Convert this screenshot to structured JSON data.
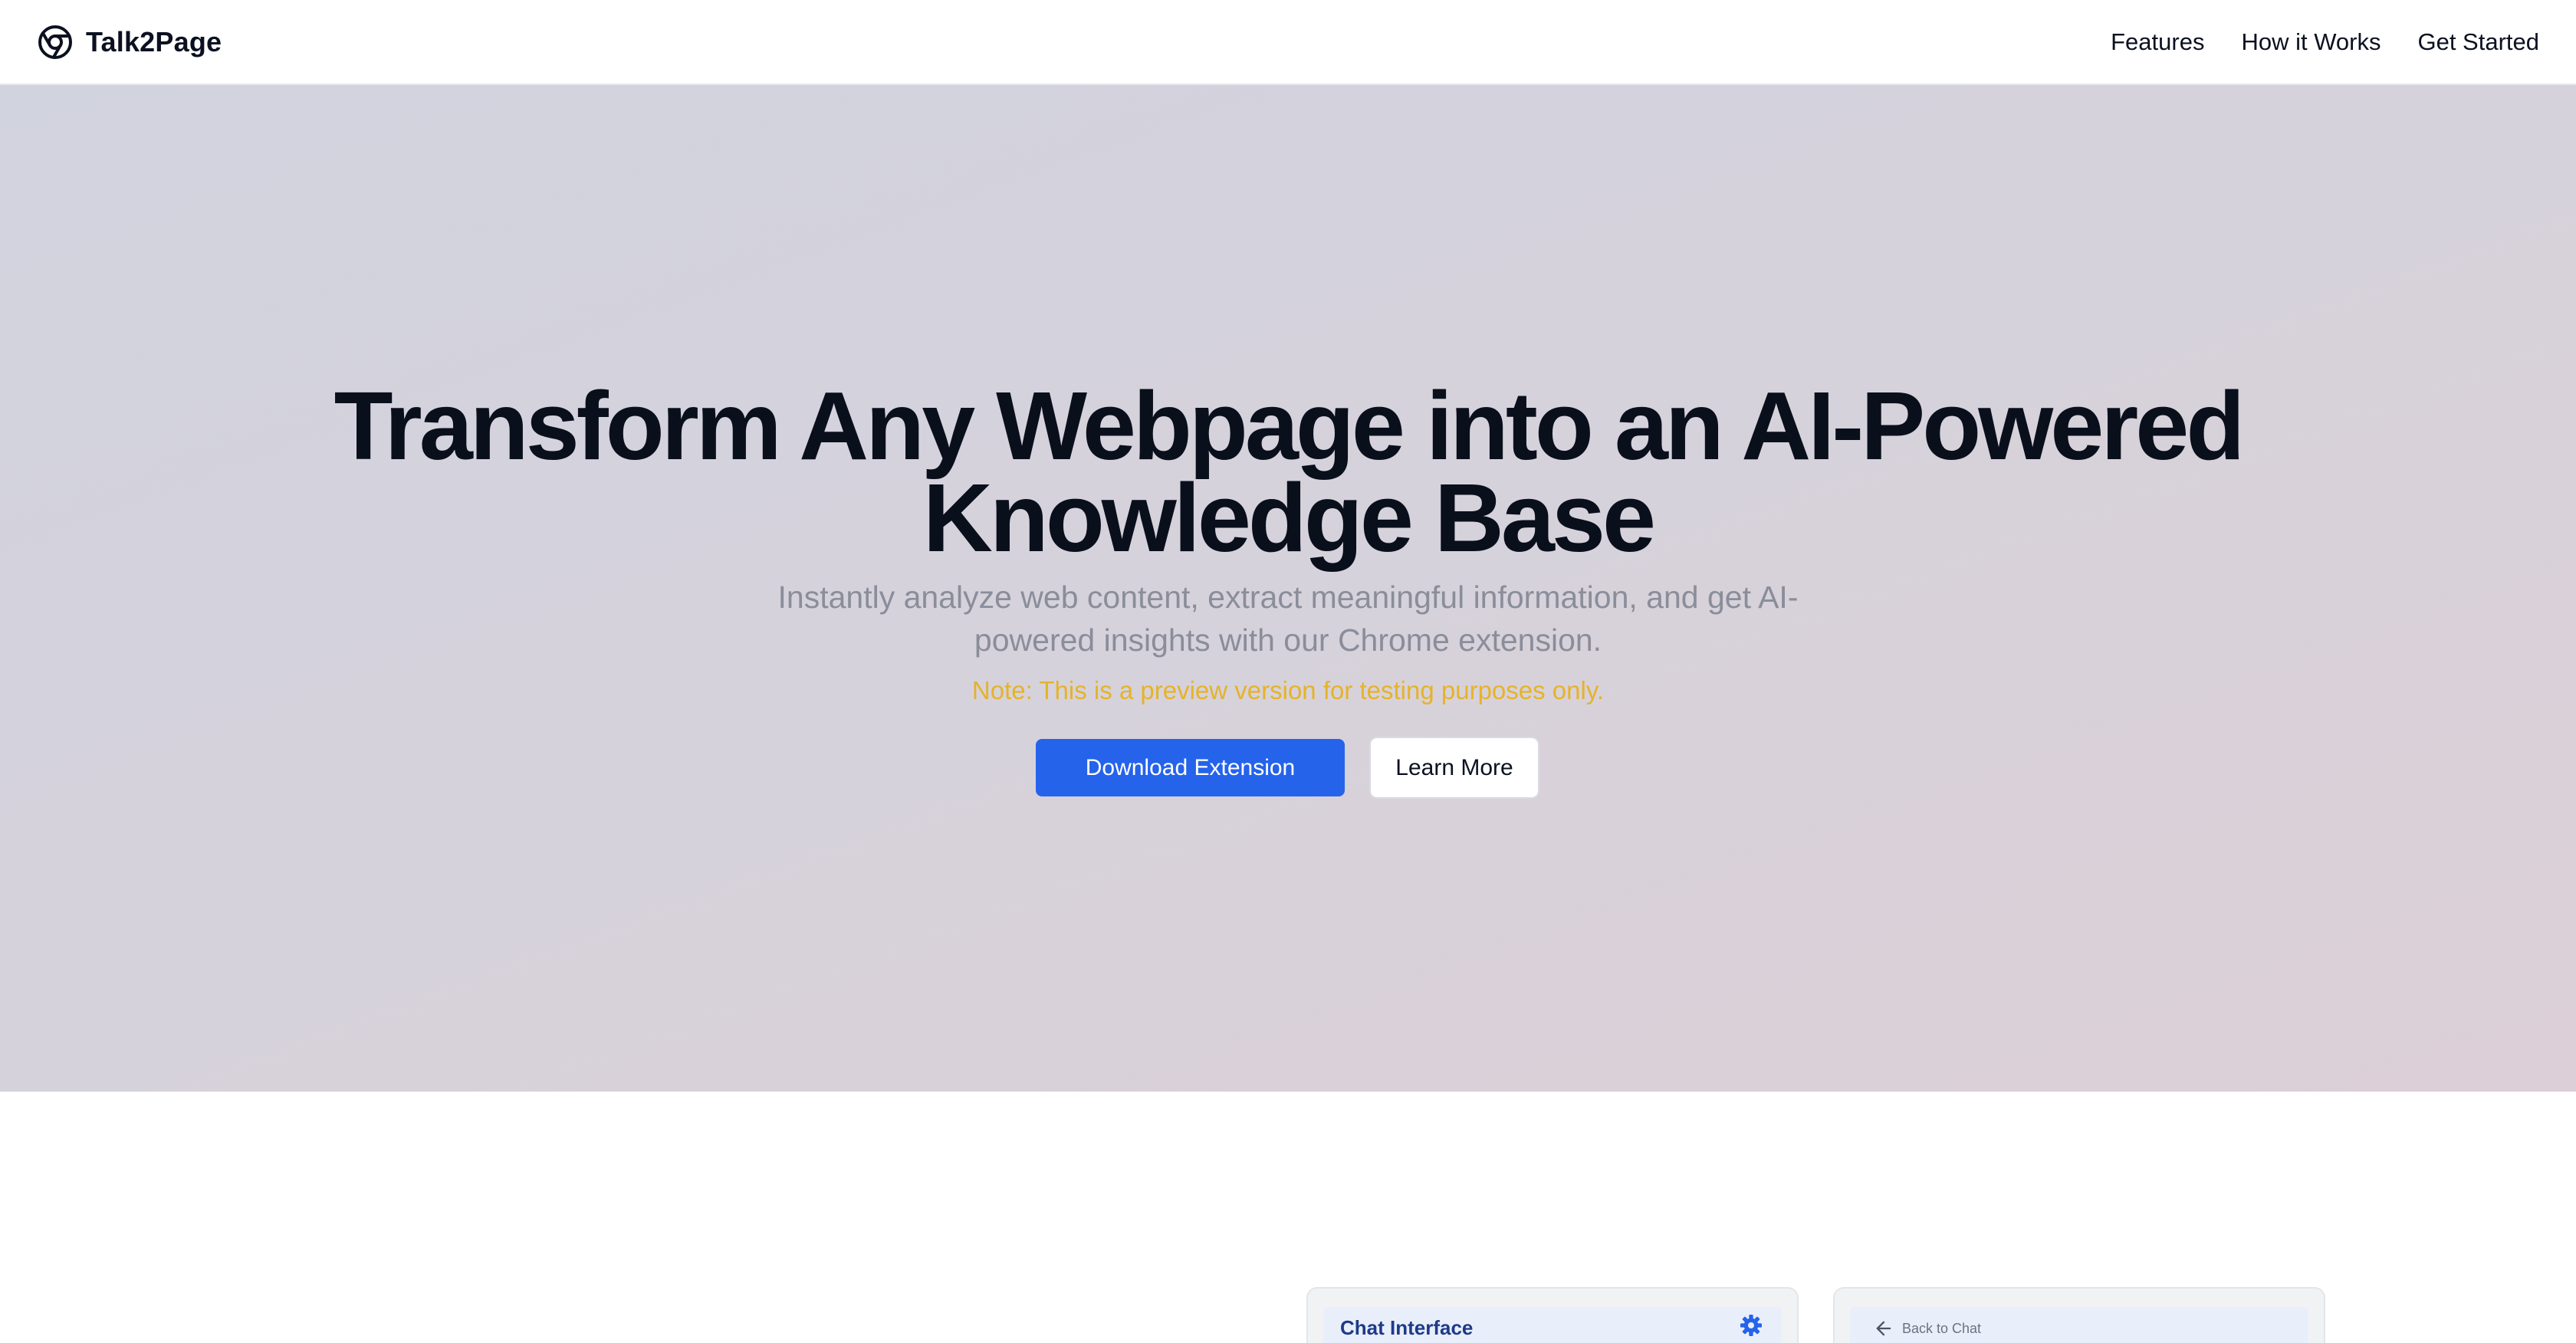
{
  "brand": {
    "name": "Talk2Page",
    "logo_icon": "chrome-icon"
  },
  "nav": {
    "links": [
      "Features",
      "How it Works",
      "Get Started"
    ]
  },
  "hero": {
    "title_line1": "Transform Any Webpage into an AI-Powered",
    "title_line2": "Knowledge Base",
    "subtitle": "Instantly analyze web content, extract meaningful information, and get AI-powered insights with our Chrome extension.",
    "note": "Note: This is a preview version for testing purposes only.",
    "primary_button": "Download Extension",
    "secondary_button": "Learn More"
  },
  "preview_cards": {
    "chat": {
      "title": "Chat Interface",
      "icon": "gear-icon"
    },
    "back": {
      "label": "Back to Chat",
      "icon": "arrow-left-icon"
    }
  },
  "colors": {
    "accent": "#2563eb",
    "note": "#e5b32a",
    "subtitle": "#8a8d9a",
    "hero_gradient_start": "#d1d3de",
    "hero_gradient_end": "#dccfd7"
  }
}
